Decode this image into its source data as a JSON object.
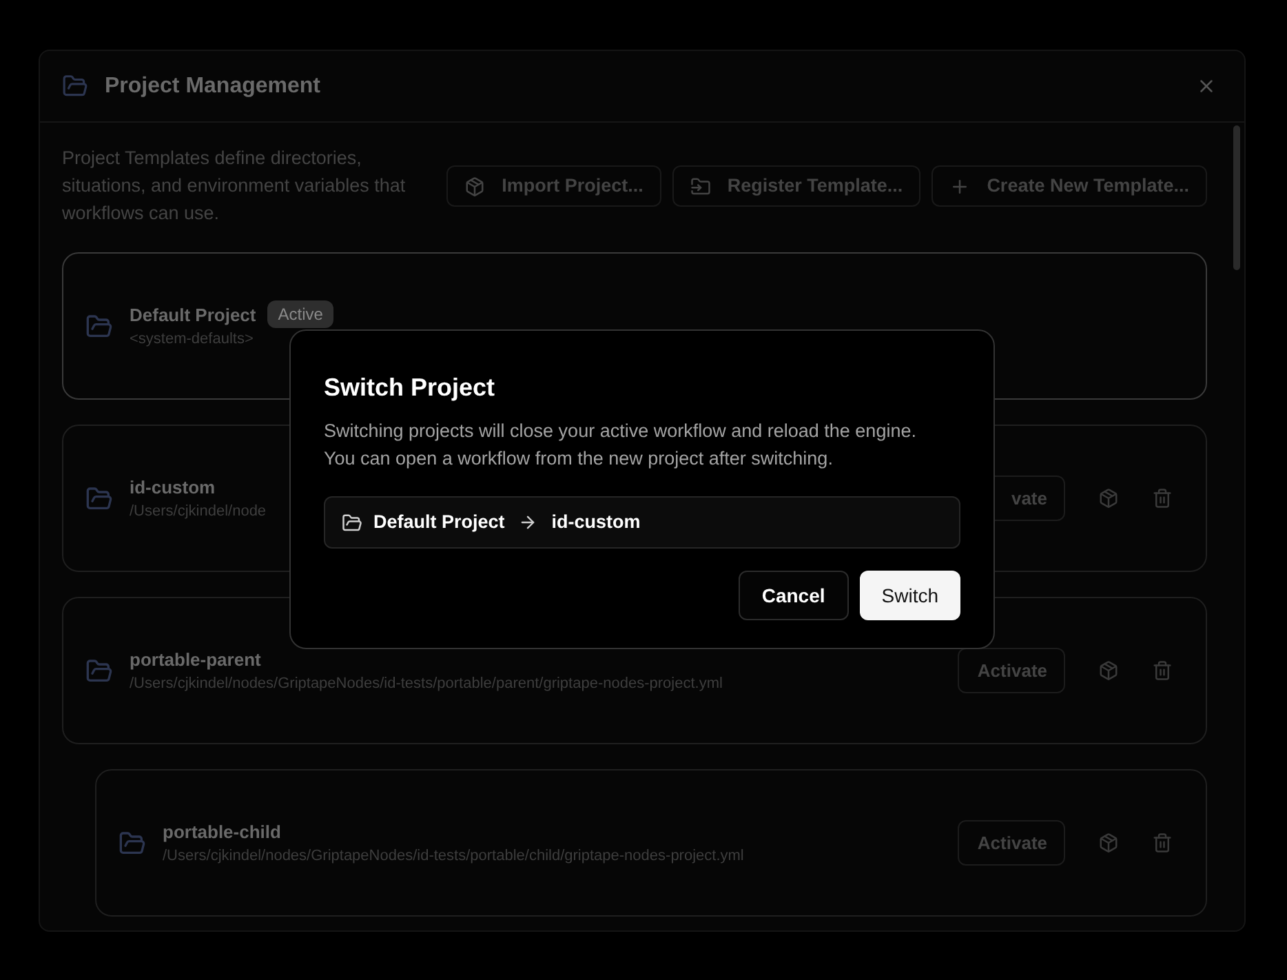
{
  "window": {
    "title": "Project Management"
  },
  "description": "Project Templates define directories, situations, and environment variables that workflows can use.",
  "toolbar": [
    {
      "label": "Import Project...",
      "kind": "import"
    },
    {
      "label": "Register Template...",
      "kind": "register"
    },
    {
      "label": "Create New Template...",
      "kind": "create"
    }
  ],
  "projects": [
    {
      "name": "Default Project",
      "path": "<system-defaults>",
      "active": true,
      "badge": "Active"
    },
    {
      "name": "id-custom",
      "path": "/Users/cjkindel/node",
      "active": false,
      "action": "vate"
    },
    {
      "name": "portable-parent",
      "path": "/Users/cjkindel/nodes/GriptapeNodes/id-tests/portable/parent/griptape-nodes-project.yml",
      "active": false,
      "action": "Activate",
      "children": [
        {
          "name": "portable-child",
          "path": "/Users/cjkindel/nodes/GriptapeNodes/id-tests/portable/child/griptape-nodes-project.yml",
          "active": false,
          "action": "Activate"
        }
      ]
    }
  ],
  "dialog": {
    "title": "Switch Project",
    "message": "Switching projects will close your active workflow and reload the engine. You can open a workflow from the new project after switching.",
    "from": "Default Project",
    "to": "id-custom",
    "buttons": [
      {
        "label": "Cancel",
        "kind": "secondary"
      },
      {
        "label": "Switch",
        "kind": "primary"
      }
    ]
  }
}
